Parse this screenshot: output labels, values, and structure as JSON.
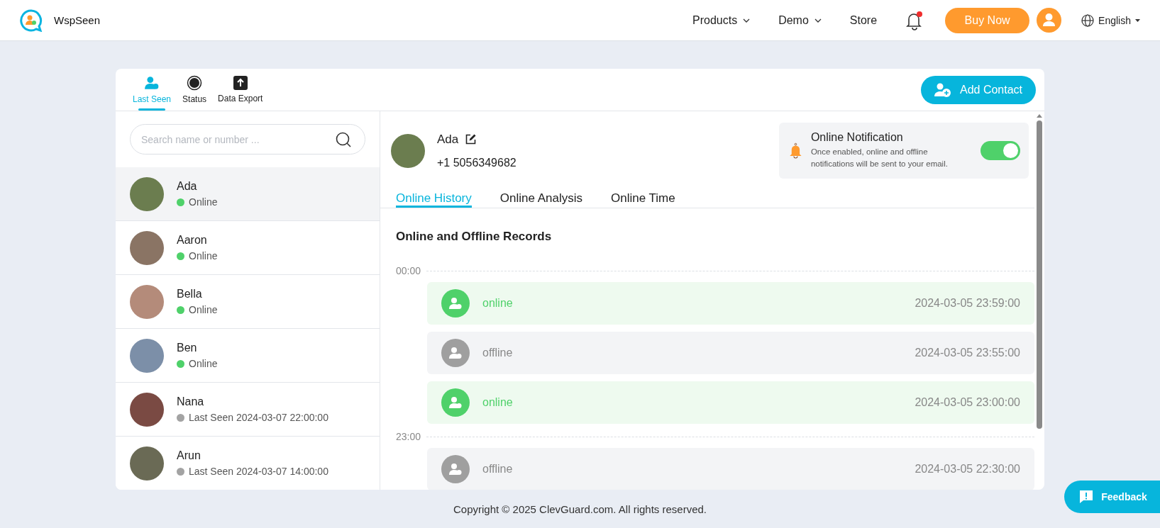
{
  "header": {
    "brand": "WspSeen",
    "nav": [
      {
        "label": "Products",
        "has_menu": true
      },
      {
        "label": "Demo",
        "has_menu": true
      },
      {
        "label": "Store",
        "has_menu": false
      }
    ],
    "has_alert": true,
    "buy_button": "Buy Now",
    "language": "English"
  },
  "tool_tabs": [
    {
      "label": "Last Seen",
      "kind": "person",
      "selected": true
    },
    {
      "label": "Status",
      "kind": "status",
      "selected": false
    },
    {
      "label": "Data Export",
      "kind": "export",
      "selected": false
    }
  ],
  "add_contact": "Add Contact",
  "search": {
    "placeholder": "Search name or number ..."
  },
  "contacts": [
    {
      "name": "Ada",
      "status": "Online",
      "online": true,
      "selected": true
    },
    {
      "name": "Aaron",
      "status": "Online",
      "online": true,
      "selected": false
    },
    {
      "name": "Bella",
      "status": "Online",
      "online": true,
      "selected": false
    },
    {
      "name": "Ben",
      "status": "Online",
      "online": true,
      "selected": false
    },
    {
      "name": "Nana",
      "status": "Last Seen 2024-03-07 22:00:00",
      "online": false,
      "selected": false
    },
    {
      "name": "Arun",
      "status": "Last Seen 2024-03-07 14:00:00",
      "online": false,
      "selected": false
    }
  ],
  "profile": {
    "name": "Ada",
    "phone": "+1 5056349682"
  },
  "notification": {
    "title": "Online Notification",
    "text": "Once enabled, online and offline notifications will be sent to your email.",
    "on": true
  },
  "detail_tabs": [
    {
      "label": "Online History",
      "selected": true
    },
    {
      "label": "Online Analysis",
      "selected": false
    },
    {
      "label": "Online Time",
      "selected": false
    }
  ],
  "records_title": "Online and Offline Records",
  "record_groups": [
    {
      "time": "00:00",
      "records": [
        {
          "kind": "online",
          "label": "online",
          "time": "2024-03-05 23:59:00"
        },
        {
          "kind": "offline",
          "label": "offline",
          "time": "2024-03-05 23:55:00"
        },
        {
          "kind": "online",
          "label": "online",
          "time": "2024-03-05 23:00:00"
        }
      ]
    },
    {
      "time": "23:00",
      "records": [
        {
          "kind": "offline",
          "label": "offline",
          "time": "2024-03-05 22:30:00"
        }
      ]
    }
  ],
  "footer": "Copyright © 2025 ClevGuard.com. All rights reserved.",
  "feedback": "Feedback"
}
